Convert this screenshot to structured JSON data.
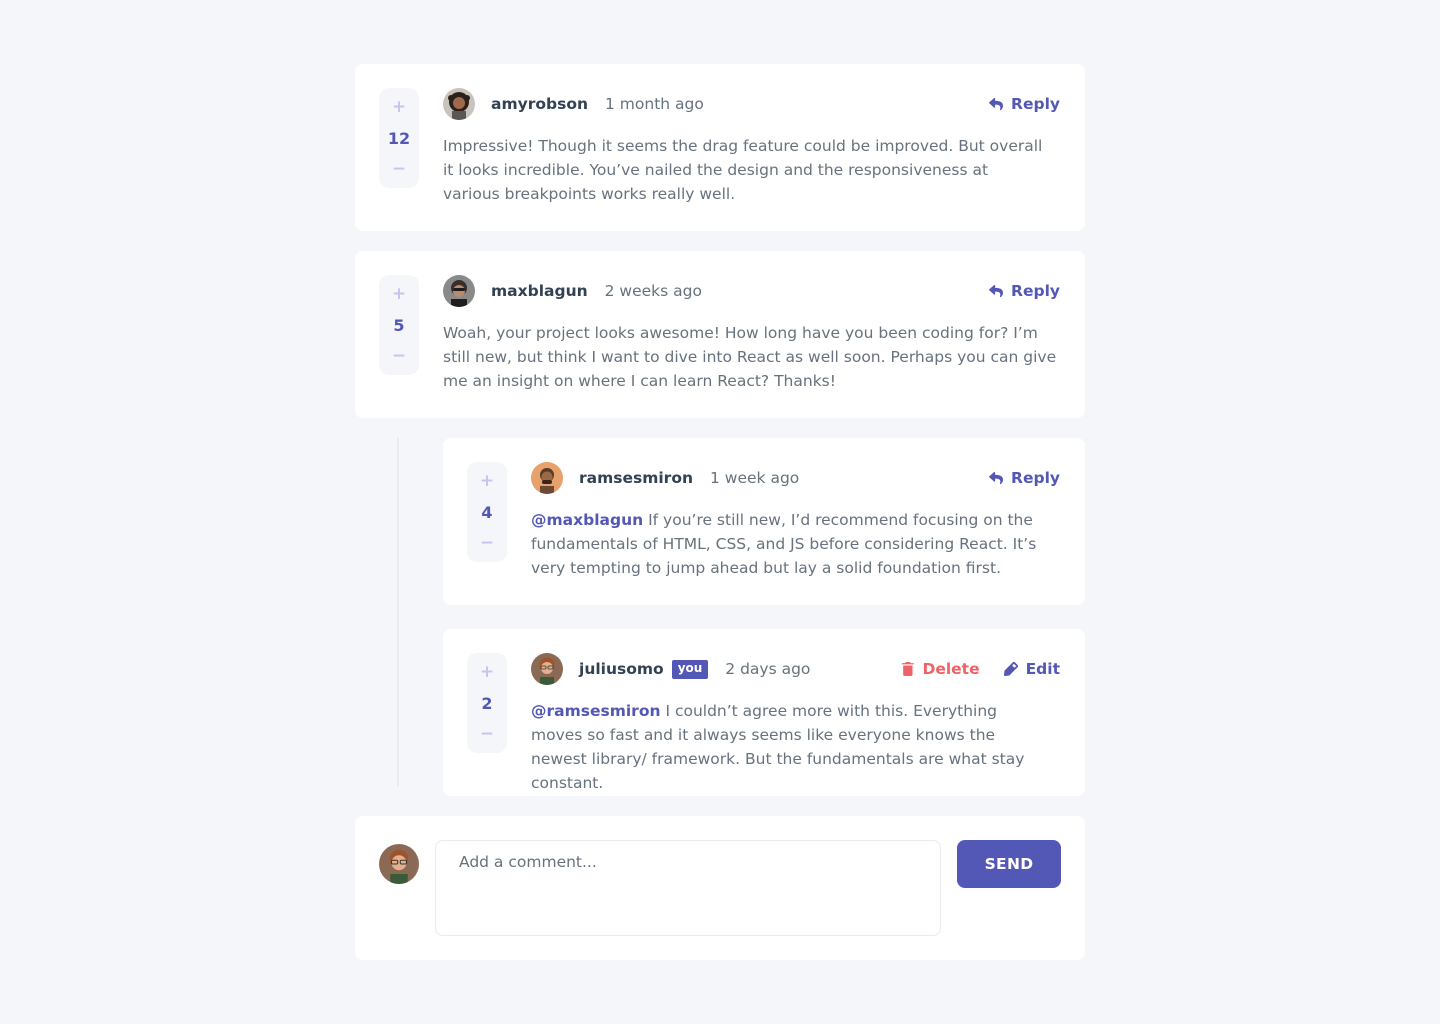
{
  "comments": [
    {
      "score": "12",
      "username": "amyrobson",
      "time": "1 month ago",
      "content": "Impressive! Though it seems the drag feature could be improved. But overall it looks incredible. You’ve nailed the design and the responsiveness at various breakpoints works really well.",
      "reply_label": "Reply"
    },
    {
      "score": "5",
      "username": "maxblagun",
      "time": "2 weeks ago",
      "content": "Woah, your project looks awesome! How long have you been coding for? I’m still new, but think I want to dive into React as well soon. Perhaps you can give me an insight on where I can learn React? Thanks!",
      "reply_label": "Reply"
    }
  ],
  "replies": [
    {
      "score": "4",
      "username": "ramsesmiron",
      "time": "1 week ago",
      "replying_to": "@maxblagun",
      "content": "If you’re still new, I’d recommend focusing on the fundamentals of HTML, CSS, and JS before considering React. It’s very tempting to jump ahead but lay a solid foundation first.",
      "reply_label": "Reply"
    },
    {
      "score": "2",
      "username": "juliusomo",
      "you_badge": "you",
      "time": "2 days ago",
      "replying_to": "@ramsesmiron",
      "content": "I couldn’t agree more with this. Everything moves so fast and it always seems like everyone knows the newest library/ framework. But the fundamentals are what stay constant.",
      "delete_label": "Delete",
      "edit_label": "Edit"
    }
  ],
  "vote": {
    "plus": "+",
    "minus": "−"
  },
  "new_comment": {
    "placeholder": "Add a comment...",
    "send_label": "SEND"
  },
  "colors": {
    "moderate_blue": "#5357b6",
    "light_grayish_blue": "#c5c6ef",
    "soft_red": "#ed6368",
    "dark_blue": "#334253",
    "grayish_blue": "#67727e",
    "light_gray": "#f5f6fa"
  },
  "icons": {
    "reply": "reply-icon",
    "delete": "trash-icon",
    "edit": "pencil-icon"
  }
}
